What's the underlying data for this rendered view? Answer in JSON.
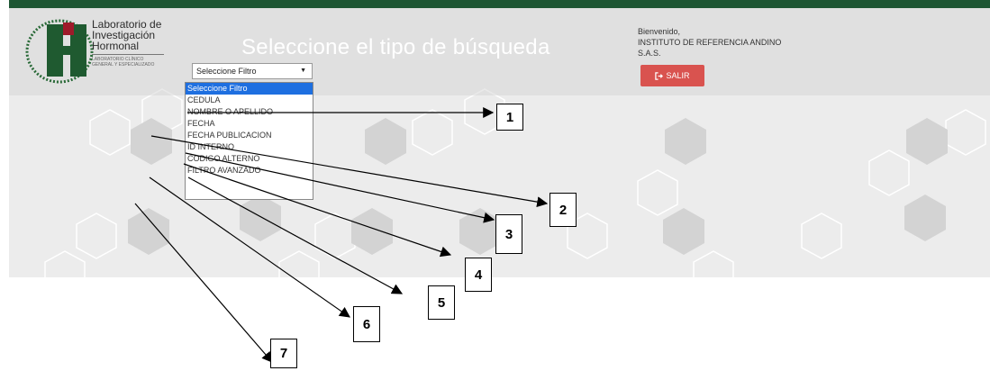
{
  "header": {
    "logo": {
      "line1": "Laboratorio de",
      "line2": "Investigación",
      "line3": "Hormonal",
      "subtitle1": "LABORATORIO CLÍNICO",
      "subtitle2": "GENERAL Y ESPECIALIZADO"
    },
    "title": "Seleccione el tipo de búsqueda",
    "welcome": "Bienvenido,",
    "user": "INSTITUTO DE REFERENCIA ANDINO",
    "user_suffix": "S.A.S.",
    "logout_label": "SALIR",
    "logout_icon": "sign-out-icon"
  },
  "filter": {
    "selected": "Seleccione Filtro",
    "options": [
      "Seleccione Filtro",
      "CEDULA",
      "NOMBRE O APELLIDO",
      "FECHA",
      "FECHA PUBLICACION",
      "ID INTERNO",
      "CODIGO ALTERNO",
      "FILTRO AVANZADO"
    ]
  },
  "annotations": [
    "1",
    "2",
    "3",
    "4",
    "5",
    "6",
    "7"
  ],
  "colors": {
    "topbar": "#1e5634",
    "title": "#ffffff",
    "logout": "#d9534f",
    "selected_option": "#1e6fe0"
  }
}
